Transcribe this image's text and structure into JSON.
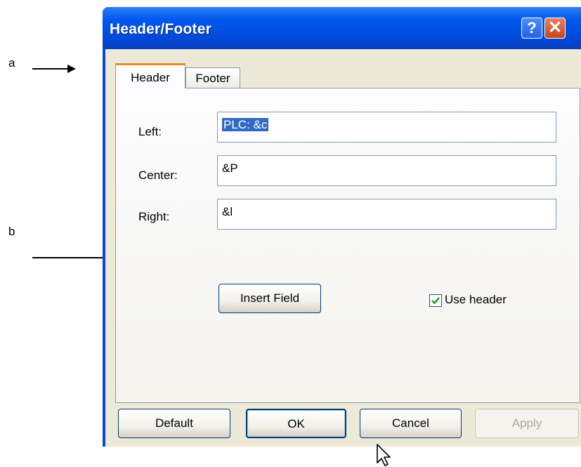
{
  "annotations": {
    "a": "a",
    "b": "b"
  },
  "window": {
    "title": "Header/Footer",
    "help_glyph": "?",
    "close_glyph": "✕"
  },
  "tabs": [
    {
      "label": "Header",
      "selected": true
    },
    {
      "label": "Footer",
      "selected": false
    }
  ],
  "fields": {
    "left": {
      "label": "Left:",
      "value": "PLC: &c"
    },
    "center": {
      "label": "Center:",
      "value": "&P"
    },
    "right": {
      "label": "Right:",
      "value": "&l"
    }
  },
  "insert_field_label": "Insert Field",
  "use_header": {
    "label": "Use header",
    "checked": true
  },
  "buttons": {
    "default": "Default",
    "ok": "OK",
    "cancel": "Cancel",
    "apply": "Apply"
  },
  "colors": {
    "titlebar": "#0058ee",
    "tab_accent": "#e68b2c",
    "checkmark": "#21a121"
  },
  "icons": [
    "help-icon",
    "close-icon",
    "checkmark-icon",
    "mouse-pointer-icon"
  ]
}
